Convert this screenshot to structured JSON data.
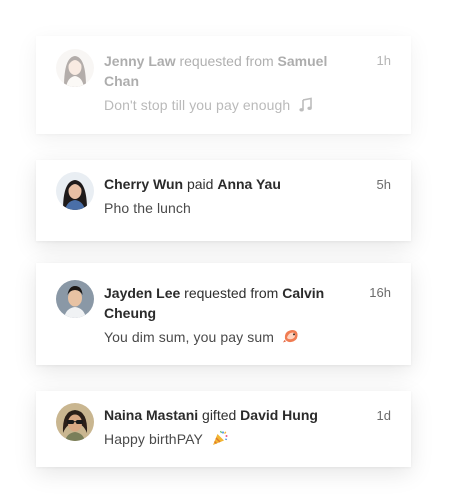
{
  "feed": {
    "items": [
      {
        "actor": "Jenny Law",
        "verb": "requested from",
        "target": "Samuel Chan",
        "message": "Don't stop till you pay enough",
        "time": "1h",
        "icon": "music-note-icon"
      },
      {
        "actor": "Cherry Wun",
        "verb": "paid",
        "target": "Anna Yau",
        "message": "Pho the lunch",
        "time": "5h"
      },
      {
        "actor": "Jayden Lee",
        "verb": "requested from",
        "target": "Calvin Cheung",
        "message": "You dim sum, you pay sum",
        "time": "16h",
        "icon": "shrimp-icon"
      },
      {
        "actor": "Naina Mastani",
        "verb": "gifted",
        "target": "David Hung",
        "message": "Happy birthPAY",
        "time": "1d",
        "icon": "party-popper-icon"
      }
    ]
  },
  "colors": {
    "card_bg": "#ffffff",
    "text_primary": "#2b2b2b",
    "text_secondary": "#4a4a4a",
    "text_time": "#6b6b6b"
  }
}
